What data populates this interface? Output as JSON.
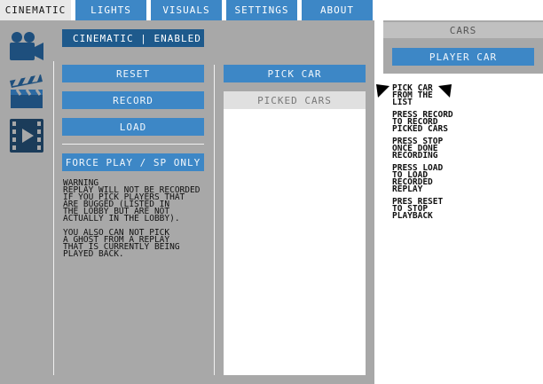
{
  "tabs": [
    {
      "label": "CINEMATIC",
      "active": true
    },
    {
      "label": "LIGHTS",
      "active": false
    },
    {
      "label": "VISUALS",
      "active": false
    },
    {
      "label": "SETTINGS",
      "active": false
    },
    {
      "label": "ABOUT",
      "active": false
    }
  ],
  "sidebar": {
    "icons": [
      "video-camera-icon",
      "clapperboard-icon",
      "film-play-icon"
    ]
  },
  "status": {
    "label": "CINEMATIC | ENABLED"
  },
  "controls": {
    "reset_label": "RESET",
    "record_label": "RECORD",
    "load_label": "LOAD",
    "force_play_label": "FORCE PLAY / SP ONLY"
  },
  "warning": {
    "title": "WARNING",
    "body_1": "REPLAY WILL NOT BE RECORDED\nIF YOU PICK PLAYERS THAT\nARE BUGGED (LISTED IN\nTHE LOBBY BUT ARE NOT\nACTUALLY IN THE LOBBY).",
    "body_2": "YOU ALSO CAN NOT PICK\nA GHOST FROM A REPLAY\nTHAT IS CURRENTLY BEING\nPLAYED BACK."
  },
  "picker": {
    "pick_car_label": "PICK CAR",
    "picked_cars_header": "PICKED CARS"
  },
  "cars_panel": {
    "header": "CARS",
    "player_car_label": "PLAYER CAR"
  },
  "instructions": {
    "step_1": "PICK CAR\nFROM THE\nLIST",
    "step_2": "PRESS RECORD\nTO RECORD\nPICKED CARS",
    "step_3": "PRESS STOP\nONCE DONE\nRECORDING",
    "step_4": "PRESS LOAD\nTO LOAD\nRECORDED\nREPLAY",
    "step_5": "PRES RESET\nTO STOP\nPLAYBACK"
  },
  "colors": {
    "accent": "#3d87c6",
    "status_bg": "#1e5a8c",
    "panel_bg": "#a8a8a8",
    "warning": "#7a0b0b"
  }
}
